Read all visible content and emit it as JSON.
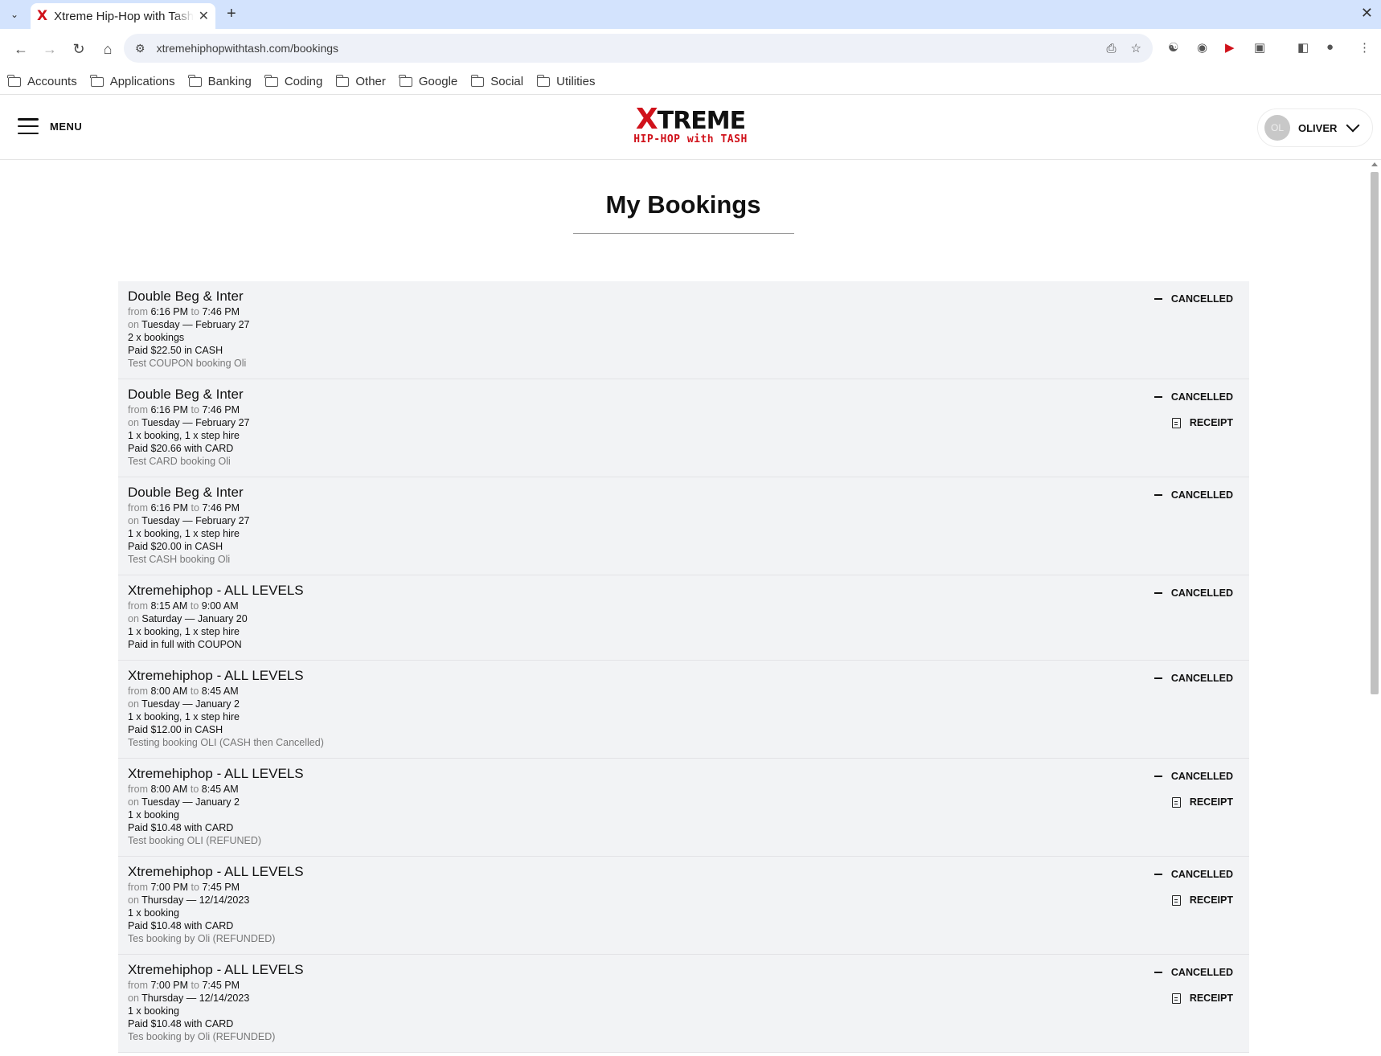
{
  "browser": {
    "tab_title": "Xtreme Hip-Hop with Tash",
    "url": "xtremehiphopwithtash.com/bookings",
    "bookmarks": [
      "Accounts",
      "Applications",
      "Banking",
      "Coding",
      "Other",
      "Google",
      "Social",
      "Utilities"
    ]
  },
  "header": {
    "menu_label": "MENU",
    "logo_main": "TREME",
    "logo_x": "X",
    "logo_sub": "HIP-HOP with TASH",
    "user_initials": "OL",
    "user_name": "OLIVER"
  },
  "page": {
    "title": "My Bookings"
  },
  "labels": {
    "from": "from",
    "to": "to",
    "on": "on",
    "cancelled": "CANCELLED",
    "receipt": "RECEIPT"
  },
  "bookings": [
    {
      "title": "Double Beg & Inter",
      "start": "6:16 PM",
      "end": "7:46 PM",
      "date": "Tuesday — February 27",
      "qty": "2 x bookings",
      "paid": "Paid $22.50 in CASH",
      "note": "Test COUPON booking Oli",
      "status": "CANCELLED",
      "receipt": false
    },
    {
      "title": "Double Beg & Inter",
      "start": "6:16 PM",
      "end": "7:46 PM",
      "date": "Tuesday — February 27",
      "qty": "1 x booking, 1 x step hire",
      "paid": "Paid $20.66 with CARD",
      "note": "Test CARD booking Oli",
      "status": "CANCELLED",
      "receipt": true
    },
    {
      "title": "Double Beg & Inter",
      "start": "6:16 PM",
      "end": "7:46 PM",
      "date": "Tuesday — February 27",
      "qty": "1 x booking, 1 x step hire",
      "paid": "Paid $20.00 in CASH",
      "note": "Test CASH booking Oli",
      "status": "CANCELLED",
      "receipt": false
    },
    {
      "title": "Xtremehiphop - ALL LEVELS",
      "start": "8:15 AM",
      "end": "9:00 AM",
      "date": "Saturday — January 20",
      "qty": "1 x booking, 1 x step hire",
      "paid": "Paid in full with COUPON",
      "note": "",
      "status": "CANCELLED",
      "receipt": false
    },
    {
      "title": "Xtremehiphop - ALL LEVELS",
      "start": "8:00 AM",
      "end": "8:45 AM",
      "date": "Tuesday — January 2",
      "qty": "1 x booking, 1 x step hire",
      "paid": "Paid $12.00 in CASH",
      "note": "Testing booking OLI (CASH then Cancelled)",
      "status": "CANCELLED",
      "receipt": false
    },
    {
      "title": "Xtremehiphop - ALL LEVELS",
      "start": "8:00 AM",
      "end": "8:45 AM",
      "date": "Tuesday — January 2",
      "qty": "1 x booking",
      "paid": "Paid $10.48 with CARD",
      "note": "Test booking OLI (REFUNED)",
      "status": "CANCELLED",
      "receipt": true
    },
    {
      "title": "Xtremehiphop - ALL LEVELS",
      "start": "7:00 PM",
      "end": "7:45 PM",
      "date": "Thursday — 12/14/2023",
      "qty": "1 x booking",
      "paid": "Paid $10.48 with CARD",
      "note": "Tes booking by Oli (REFUNDED)",
      "status": "CANCELLED",
      "receipt": true
    },
    {
      "title": "Xtremehiphop - ALL LEVELS",
      "start": "7:00 PM",
      "end": "7:45 PM",
      "date": "Thursday — 12/14/2023",
      "qty": "1 x booking",
      "paid": "Paid $10.48 with CARD",
      "note": "Tes booking by Oli (REFUNDED)",
      "status": "CANCELLED",
      "receipt": true
    }
  ]
}
